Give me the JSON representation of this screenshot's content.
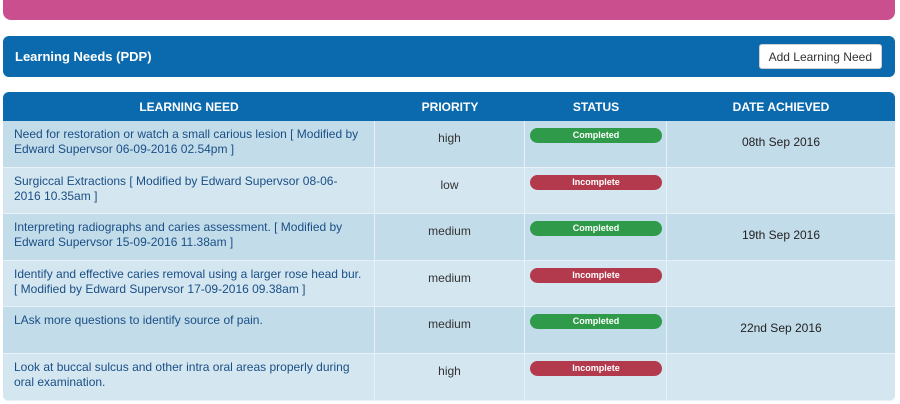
{
  "colors": {
    "banner": "#c94f8f",
    "header_blue": "#0b6aad",
    "completed": "#2e9a4a",
    "incomplete": "#b23a4c"
  },
  "section": {
    "title": "Learning Needs (PDP)",
    "add_button": "Add Learning Need"
  },
  "table": {
    "headers": {
      "need": "LEARNING NEED",
      "priority": "PRIORITY",
      "status": "STATUS",
      "date": "DATE ACHIEVED"
    },
    "rows": [
      {
        "need": "Need for restoration or watch a small carious lesion [ Modified by Edward Supervsor 06-09-2016 02.54pm ]",
        "priority": "high",
        "status": "Completed",
        "date": "08th Sep 2016"
      },
      {
        "need": "Surgiccal Extractions [ Modified by Edward Supervsor 08-06-2016 10.35am ]",
        "priority": "low",
        "status": "Incomplete",
        "date": ""
      },
      {
        "need": "Interpreting radiographs and caries assessment. [ Modified by Edward Supervsor 15-09-2016 11.38am ]",
        "priority": "medium",
        "status": "Completed",
        "date": "19th Sep 2016"
      },
      {
        "need": "Identify and effective caries removal using a larger rose head bur.  [ Modified by Edward Supervsor 17-09-2016 09.38am ]",
        "priority": "medium",
        "status": "Incomplete",
        "date": ""
      },
      {
        "need": "LAsk more questions to identify source of pain.",
        "priority": "medium",
        "status": "Completed",
        "date": "22nd Sep 2016"
      },
      {
        "need": "Look at buccal sulcus and other intra oral areas properly during oral examination.",
        "priority": "high",
        "status": "Incomplete",
        "date": ""
      }
    ]
  }
}
